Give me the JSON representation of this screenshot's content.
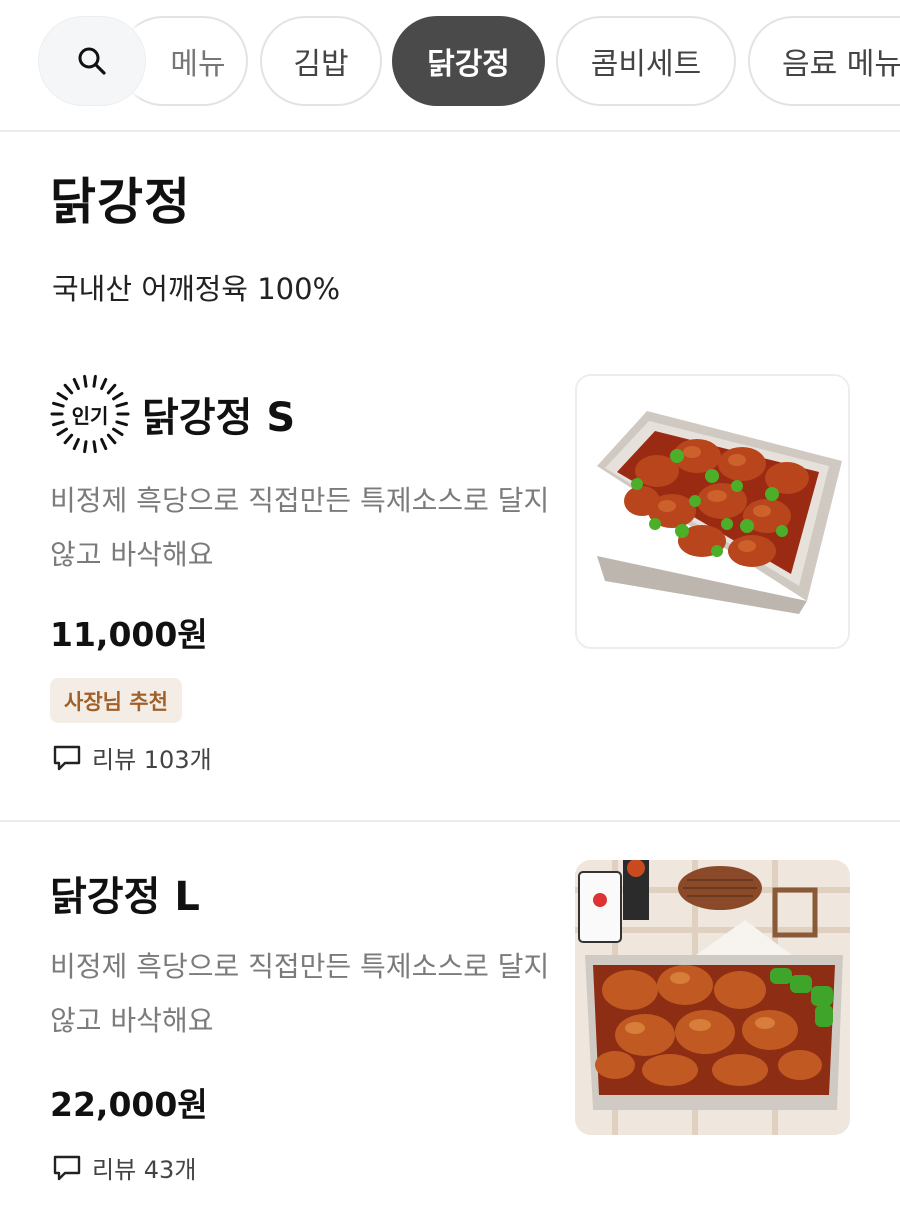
{
  "category_bar": {
    "search_icon": "search-icon",
    "tabs": [
      {
        "label": "메뉴",
        "active": false
      },
      {
        "label": "김밥",
        "active": false
      },
      {
        "label": "닭강정",
        "active": true
      },
      {
        "label": "콤비세트",
        "active": false
      },
      {
        "label": "음료 메뉴",
        "active": false
      }
    ]
  },
  "section": {
    "title": "닭강정",
    "description": "국내산 어깨정육 100%"
  },
  "items": [
    {
      "badge": "인기",
      "name": "닭강정 S",
      "description": "비정제 흑당으로 직접만든 특제소스로 달지않고 바삭해요",
      "price": "11,000원",
      "tag": "사장님 추천",
      "review": "리뷰 103개"
    },
    {
      "name": "닭강정 L",
      "description": "비정제 흑당으로 직접만든 특제소스로 달지않고 바삭해요",
      "price": "22,000원",
      "review": "리뷰 43개"
    }
  ],
  "colors": {
    "active_chip": "#4a4a4a",
    "tag_bg": "#f4ede6",
    "tag_text": "#a0602a",
    "muted_text": "#7b7b7b"
  }
}
